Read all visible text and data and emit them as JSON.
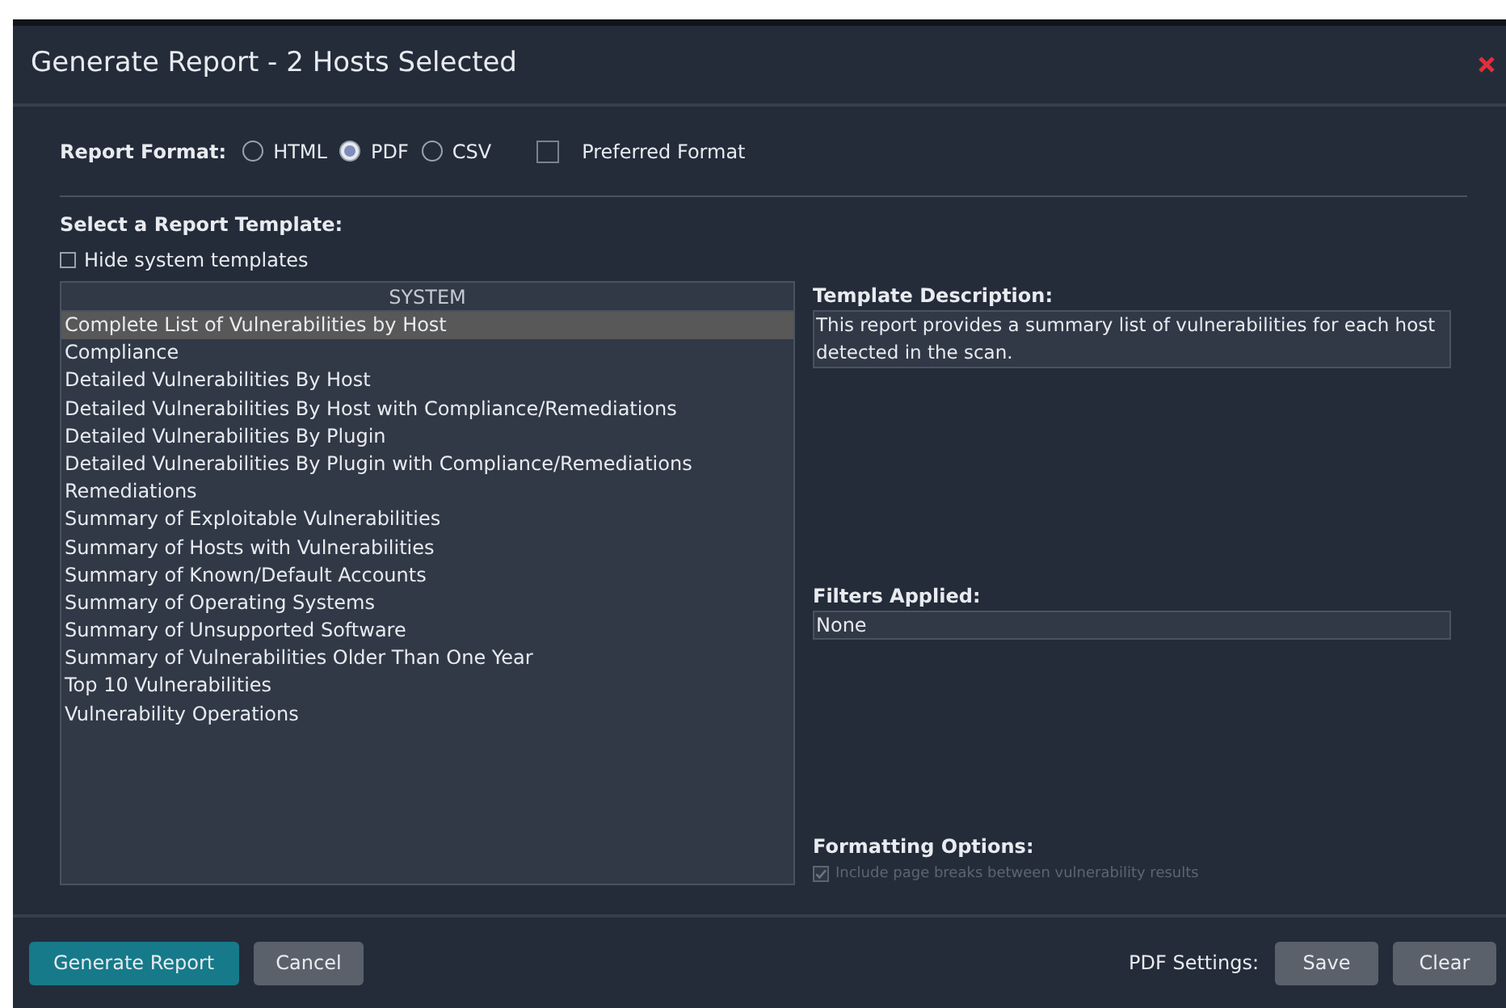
{
  "window": {
    "title": "Generate Report - 2 Hosts Selected"
  },
  "report_format": {
    "label": "Report Format:",
    "options": [
      {
        "label": "HTML",
        "selected": false
      },
      {
        "label": "PDF",
        "selected": true
      },
      {
        "label": "CSV",
        "selected": false
      }
    ],
    "preferred": {
      "label": "Preferred Format",
      "checked": false
    }
  },
  "template_section": {
    "title": "Select a Report Template:",
    "hide_system": {
      "label": "Hide system templates",
      "checked": false
    }
  },
  "template_list": {
    "header": "SYSTEM",
    "items": [
      {
        "label": "Complete List of Vulnerabilities by Host",
        "selected": true
      },
      {
        "label": "Compliance",
        "selected": false
      },
      {
        "label": "Detailed Vulnerabilities By Host",
        "selected": false
      },
      {
        "label": "Detailed Vulnerabilities By Host with Compliance/Remediations",
        "selected": false
      },
      {
        "label": "Detailed Vulnerabilities By Plugin",
        "selected": false
      },
      {
        "label": "Detailed Vulnerabilities By Plugin with Compliance/Remediations",
        "selected": false
      },
      {
        "label": "Remediations",
        "selected": false
      },
      {
        "label": "Summary of Exploitable Vulnerabilities",
        "selected": false
      },
      {
        "label": "Summary of Hosts with Vulnerabilities",
        "selected": false
      },
      {
        "label": "Summary of Known/Default Accounts",
        "selected": false
      },
      {
        "label": "Summary of Operating Systems",
        "selected": false
      },
      {
        "label": "Summary of Unsupported Software",
        "selected": false
      },
      {
        "label": "Summary of Vulnerabilities Older Than One Year",
        "selected": false
      },
      {
        "label": "Top 10 Vulnerabilities",
        "selected": false
      },
      {
        "label": "Vulnerability Operations",
        "selected": false
      }
    ]
  },
  "template_description": {
    "label": "Template Description:",
    "text": "This report provides a summary list of vulnerabilities for each host detected in the scan."
  },
  "filters_applied": {
    "label": "Filters Applied:",
    "value": "None"
  },
  "formatting_options": {
    "label": "Formatting Options:",
    "options": [
      {
        "label": "Include page breaks between vulnerability results",
        "checked": true,
        "disabled": true
      }
    ]
  },
  "footer": {
    "generate": "Generate Report",
    "cancel": "Cancel",
    "pdf_settings_label": "PDF Settings:",
    "save": "Save",
    "clear": "Clear"
  }
}
